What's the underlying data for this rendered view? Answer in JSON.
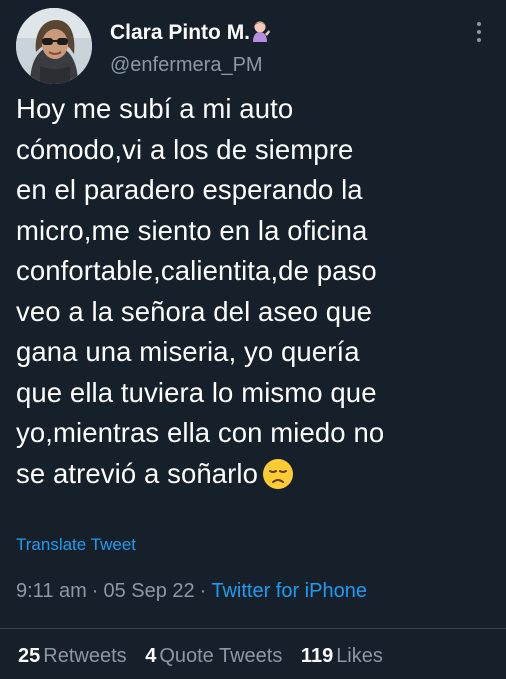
{
  "user": {
    "display_name": "Clara Pinto M.",
    "handle": "@enfermera_PM",
    "name_emoji": "woman-tipping-hand-emoji"
  },
  "tweet": {
    "lines": [
      "Hoy me subí a mi auto",
      "cómodo,vi a los de siempre",
      "en el paradero esperando la",
      "micro,me siento en la oficina",
      "confortable,calientita,de paso",
      "veo a la señora del aseo que",
      "gana una miseria, yo quería",
      "que ella tuviera lo mismo que",
      "yo,mientras ella con miedo no",
      "se atrevió a soñarlo"
    ],
    "trailing_emoji": "disappointed-face-emoji",
    "translate_label": "Translate Tweet"
  },
  "meta": {
    "time": "9:11 am",
    "separator": "·",
    "date": "05 Sep 22",
    "source": "Twitter for iPhone"
  },
  "stats": {
    "retweets_count": "25",
    "retweets_label": "Retweets",
    "quotes_count": "4",
    "quotes_label": "Quote Tweets",
    "likes_count": "119",
    "likes_label": "Likes"
  },
  "colors": {
    "background": "#15202b",
    "text": "#ffffff",
    "secondary": "#8b98a5",
    "accent": "#1d9bf0",
    "divider": "#38444d"
  }
}
